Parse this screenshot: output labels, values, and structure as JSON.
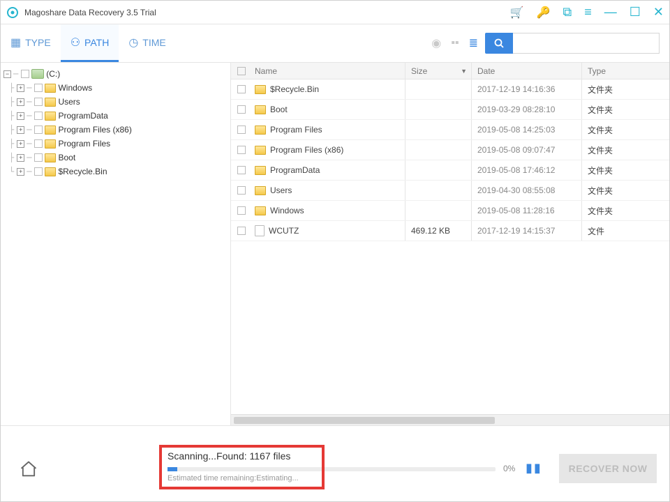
{
  "titlebar": {
    "title": "Magoshare Data Recovery 3.5 Trial"
  },
  "tabs": {
    "type": "TYPE",
    "path": "PATH",
    "time": "TIME"
  },
  "tree": {
    "root": "(C:)",
    "items": [
      "Windows",
      "Users",
      "ProgramData",
      "Program Files (x86)",
      "Program Files",
      "Boot",
      "$Recycle.Bin"
    ]
  },
  "columns": {
    "name": "Name",
    "size": "Size",
    "date": "Date",
    "type": "Type"
  },
  "rows": [
    {
      "name": "$Recycle.Bin",
      "size": "",
      "date": "2017-12-19 14:16:36",
      "type": "文件夹",
      "icon": "folder"
    },
    {
      "name": "Boot",
      "size": "",
      "date": "2019-03-29 08:28:10",
      "type": "文件夹",
      "icon": "folder"
    },
    {
      "name": "Program Files",
      "size": "",
      "date": "2019-05-08 14:25:03",
      "type": "文件夹",
      "icon": "folder"
    },
    {
      "name": "Program Files (x86)",
      "size": "",
      "date": "2019-05-08 09:07:47",
      "type": "文件夹",
      "icon": "folder"
    },
    {
      "name": "ProgramData",
      "size": "",
      "date": "2019-05-08 17:46:12",
      "type": "文件夹",
      "icon": "folder"
    },
    {
      "name": "Users",
      "size": "",
      "date": "2019-04-30 08:55:08",
      "type": "文件夹",
      "icon": "folder"
    },
    {
      "name": "Windows",
      "size": "",
      "date": "2019-05-08 11:28:16",
      "type": "文件夹",
      "icon": "folder"
    },
    {
      "name": "WCUTZ",
      "size": "469.12 KB",
      "date": "2017-12-19 14:15:37",
      "type": "文件",
      "icon": "file"
    }
  ],
  "progress": {
    "title": "Scanning...Found: 1167 files",
    "subtitle": "Estimated time remaining:Estimating...",
    "percent": "0%"
  },
  "recover_label": "RECOVER NOW"
}
